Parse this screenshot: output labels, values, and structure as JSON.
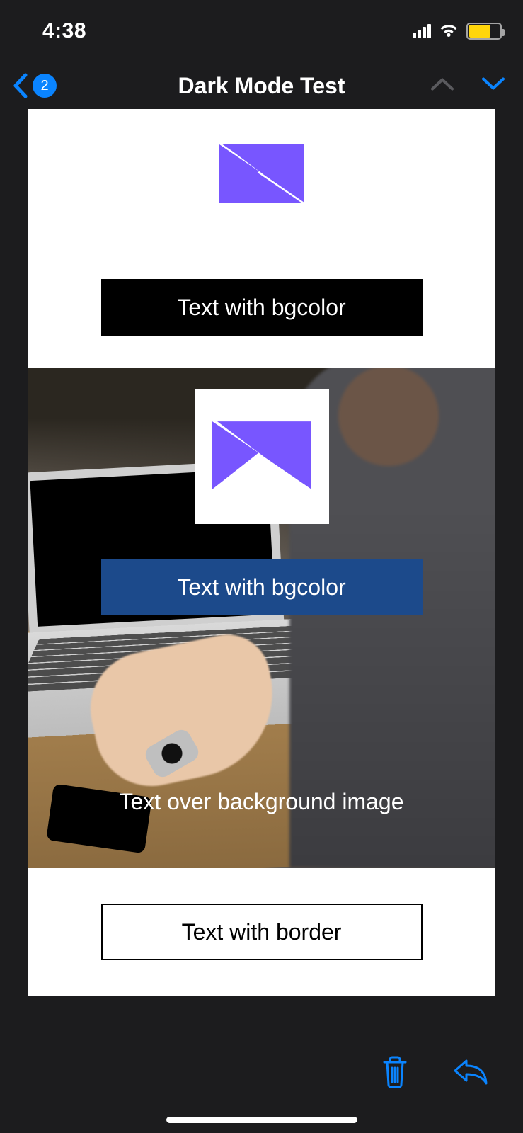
{
  "status": {
    "time": "4:38",
    "battery_percent": 65
  },
  "nav": {
    "title": "Dark Mode Test",
    "back_badge": "2"
  },
  "email": {
    "section1": {
      "btn_label": "Text with bgcolor"
    },
    "section2": {
      "btn_label": "Text with bgcolor",
      "overlay_text": "Text over background image"
    },
    "section3": {
      "btn_label": "Text with border"
    }
  },
  "icons": {
    "back": "chevron-left",
    "up": "chevron-up",
    "down": "chevron-down",
    "trash": "trash",
    "reply": "reply",
    "wifi": "wifi",
    "signal": "cell-signal",
    "battery": "battery",
    "logo": "campaign-monitor-logo"
  }
}
